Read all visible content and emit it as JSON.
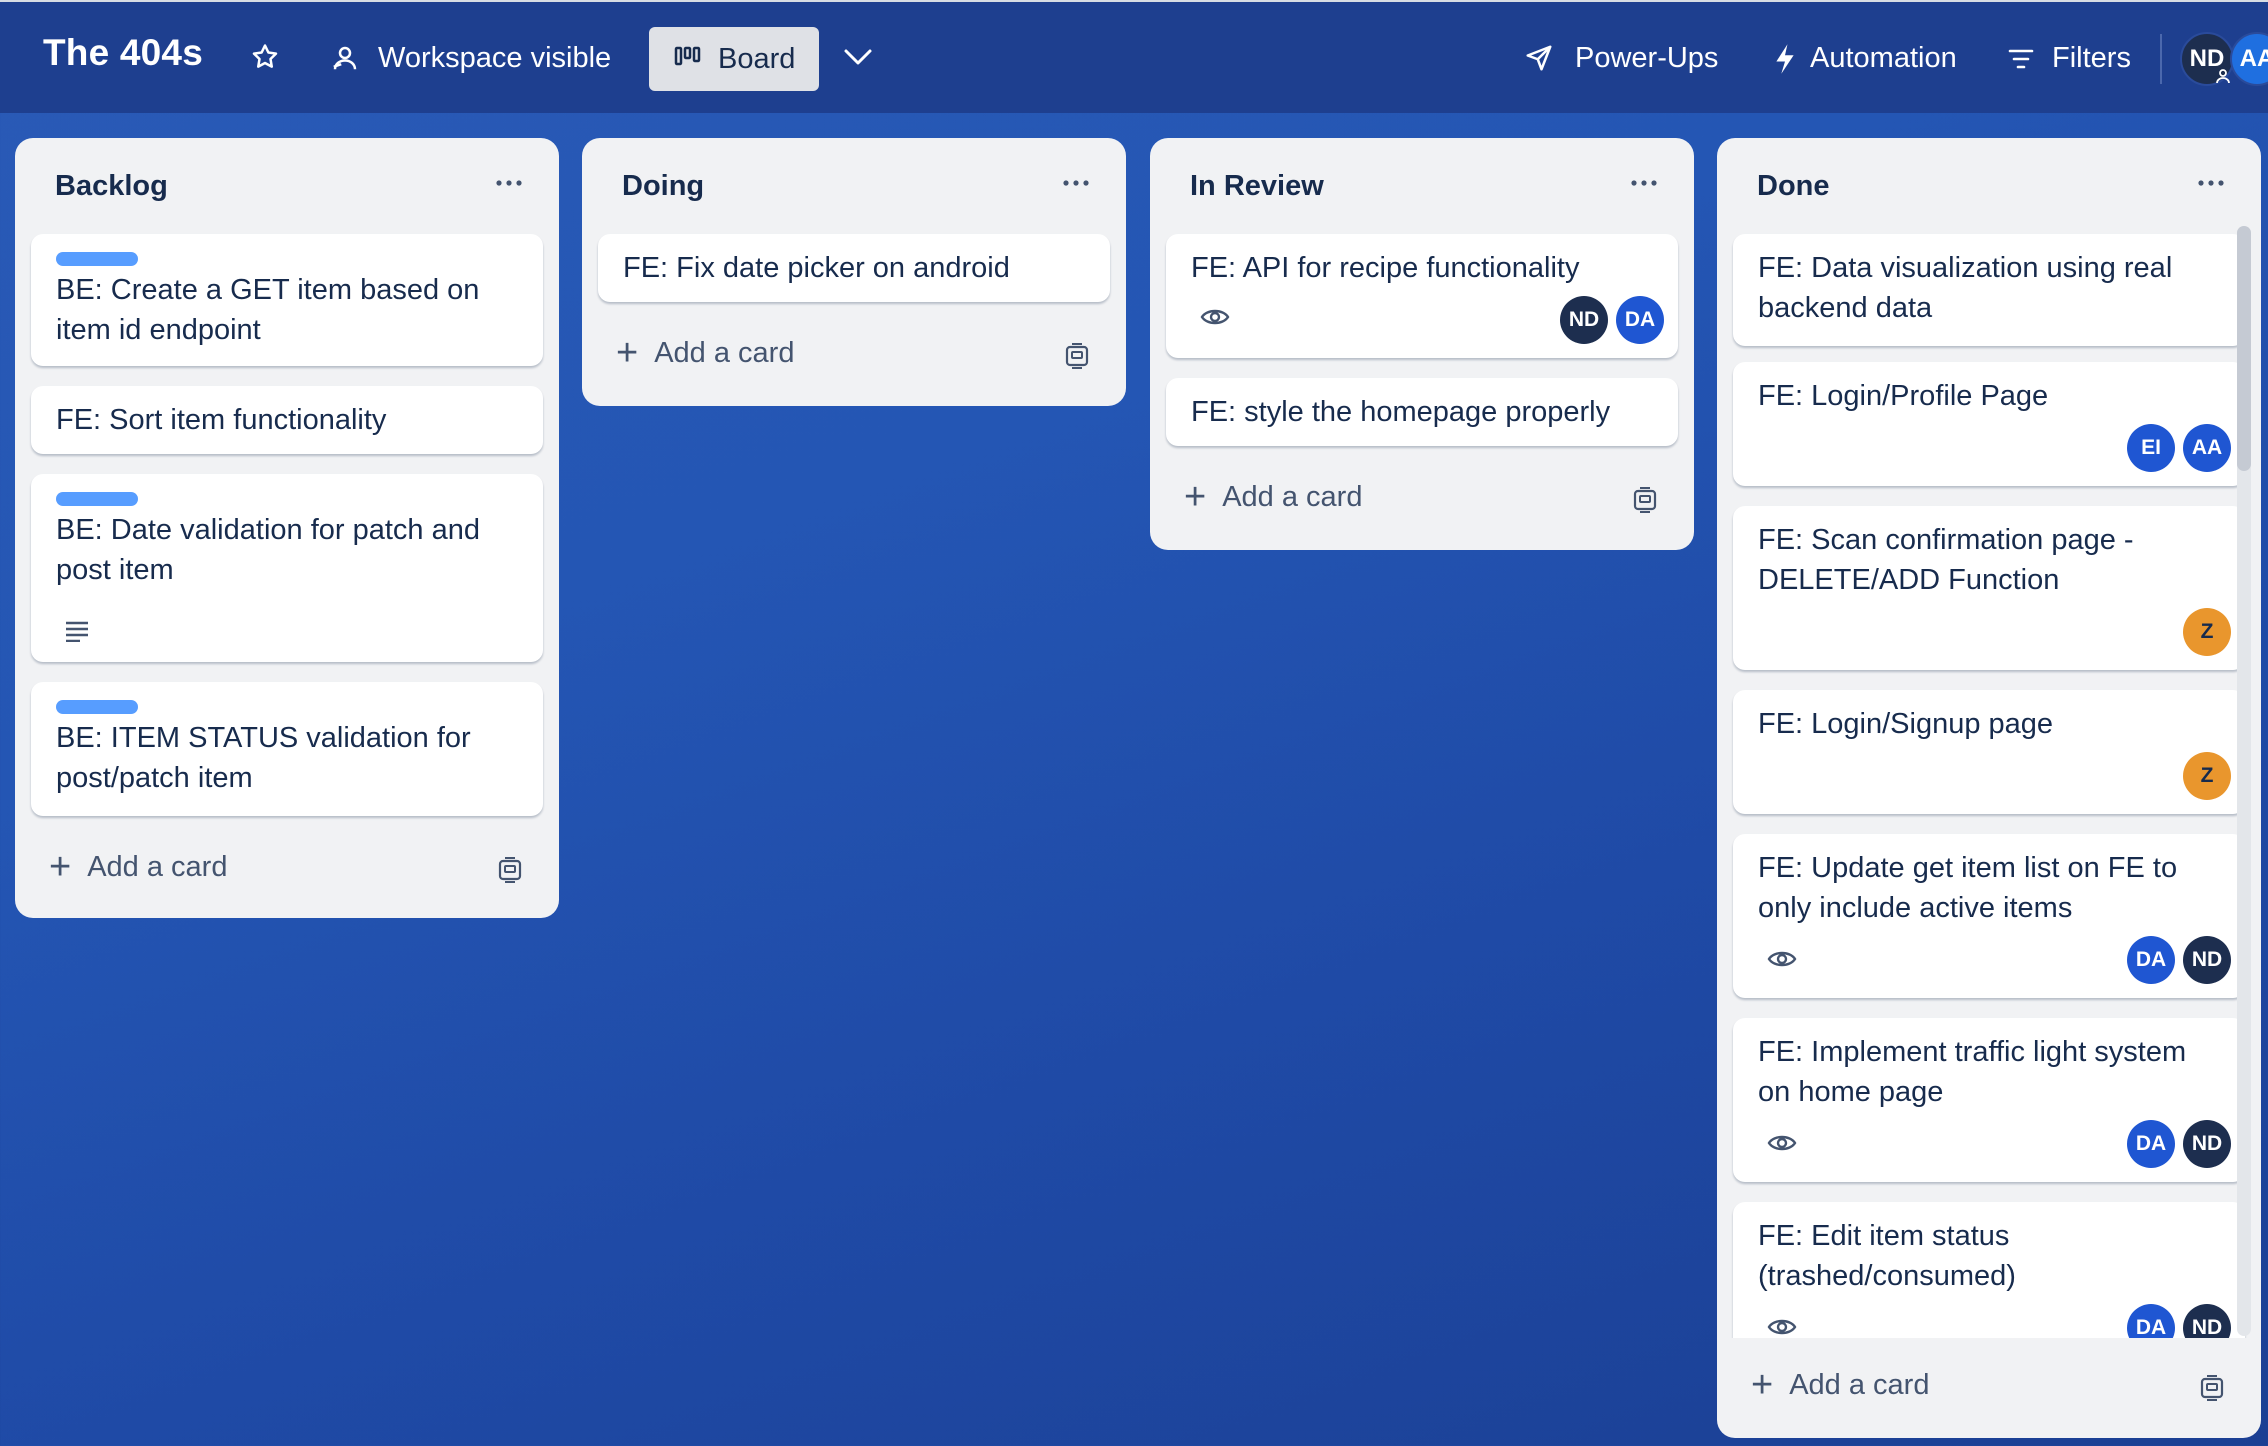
{
  "header": {
    "board_title": "The 404s",
    "visibility_label": "Workspace visible",
    "view_label": "Board",
    "powerups_label": "Power-Ups",
    "automation_label": "Automation",
    "filters_label": "Filters",
    "members": [
      {
        "initials": "ND",
        "color": "#1d2e4f"
      },
      {
        "initials": "AA",
        "color": "#1f6fe0"
      }
    ]
  },
  "lists": [
    {
      "title": "Backlog",
      "cards": [
        {
          "label_color": "#579dff",
          "text": [
            "BE: Create a GET item based on",
            "item id endpoint"
          ]
        },
        {
          "text": [
            "FE: Sort item functionality"
          ]
        },
        {
          "label_color": "#579dff",
          "text": [
            "BE: Date validation for patch and",
            "post item"
          ],
          "badges": [
            "description-icon"
          ]
        },
        {
          "label_color": "#579dff",
          "text": [
            "BE: ITEM STATUS validation for",
            "post/patch item"
          ]
        }
      ],
      "add_card_label": "Add a card"
    },
    {
      "title": "Doing",
      "cards": [
        {
          "text": [
            "FE: Fix date picker on android"
          ]
        }
      ],
      "add_card_label": "Add a card"
    },
    {
      "title": "In Review",
      "cards": [
        {
          "text": [
            "FE: API for recipe functionality"
          ],
          "badges": [
            "watch-icon"
          ],
          "members": [
            {
              "initials": "ND",
              "color": "#1d2e4f"
            },
            {
              "initials": "DA",
              "color": "#1f56d2"
            }
          ]
        },
        {
          "text": [
            "FE: style the homepage properly"
          ]
        }
      ],
      "add_card_label": "Add a card"
    },
    {
      "title": "Done",
      "cards": [
        {
          "text": [
            "FE: Data visualization using real",
            "backend data"
          ]
        },
        {
          "text": [
            "FE: Login/Profile Page"
          ],
          "members": [
            {
              "initials": "EI",
              "color": "#1f56d2"
            },
            {
              "initials": "AA",
              "color": "#1f56d2"
            }
          ]
        },
        {
          "text": [
            "FE: Scan confirmation page -",
            "DELETE/ADD Function"
          ],
          "members": [
            {
              "initials": "Z",
              "color": "#e9962d"
            }
          ]
        },
        {
          "text": [
            "FE: Login/Signup page"
          ],
          "members": [
            {
              "initials": "Z",
              "color": "#e9962d"
            }
          ]
        },
        {
          "text": [
            "FE: Update get item list on FE to",
            "only include active items"
          ],
          "badges": [
            "watch-icon"
          ],
          "members": [
            {
              "initials": "DA",
              "color": "#1f56d2"
            },
            {
              "initials": "ND",
              "color": "#1d2e4f"
            }
          ]
        },
        {
          "text": [
            "FE: Implement traffic light system",
            "on home page"
          ],
          "badges": [
            "watch-icon"
          ],
          "members": [
            {
              "initials": "DA",
              "color": "#1f56d2"
            },
            {
              "initials": "ND",
              "color": "#1d2e4f"
            }
          ]
        },
        {
          "text": [
            "FE: Edit item status",
            "(trashed/consumed)"
          ],
          "badges": [
            "watch-icon"
          ],
          "members": [
            {
              "initials": "DA",
              "color": "#1f56d2"
            },
            {
              "initials": "ND",
              "color": "#1d2e4f"
            }
          ]
        }
      ],
      "add_card_label": "Add a card"
    }
  ]
}
